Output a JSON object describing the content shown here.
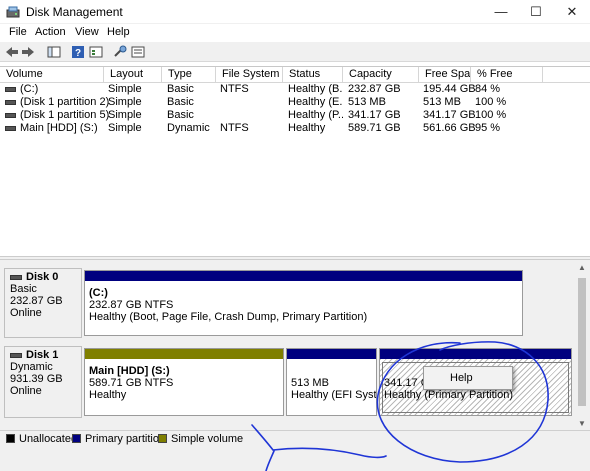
{
  "window": {
    "title": "Disk Management",
    "controls": {
      "minimize": "—",
      "maximize": "☐",
      "close": "✕"
    }
  },
  "menu": [
    "File",
    "Action",
    "View",
    "Help"
  ],
  "toolbar": {
    "icons": [
      "back-arrow-icon",
      "forward-arrow-icon",
      "console-tree-icon",
      "help-icon",
      "properties-icon",
      "connect-icon",
      "list-view-icon"
    ]
  },
  "table": {
    "columns": [
      "Volume",
      "Layout",
      "Type",
      "File System",
      "Status",
      "Capacity",
      "Free Spa...",
      "% Free"
    ],
    "rows": [
      {
        "volume": "(C:)",
        "layout": "Simple",
        "type": "Basic",
        "fs": "NTFS",
        "status": "Healthy (B...",
        "capacity": "232.87 GB",
        "free": "195.44 GB",
        "pct": "84 %"
      },
      {
        "volume": "(Disk 1 partition 2)",
        "layout": "Simple",
        "type": "Basic",
        "fs": "",
        "status": "Healthy (E...",
        "capacity": "513 MB",
        "free": "513 MB",
        "pct": "100 %"
      },
      {
        "volume": "(Disk 1 partition 5)",
        "layout": "Simple",
        "type": "Basic",
        "fs": "",
        "status": "Healthy (P...",
        "capacity": "341.17 GB",
        "free": "341.17 GB",
        "pct": "100 %"
      },
      {
        "volume": "Main [HDD] (S:)",
        "layout": "Simple",
        "type": "Dynamic",
        "fs": "NTFS",
        "status": "Healthy",
        "capacity": "589.71 GB",
        "free": "561.66 GB",
        "pct": "95 %"
      }
    ]
  },
  "disks": [
    {
      "name": "Disk 0",
      "type": "Basic",
      "size": "232.87 GB",
      "state": "Online",
      "partitions": [
        {
          "title": "(C:)",
          "detail": "232.87 GB NTFS",
          "status": "Healthy (Boot, Page File, Crash Dump, Primary Partition)",
          "color": "#00007f"
        }
      ]
    },
    {
      "name": "Disk 1",
      "type": "Dynamic",
      "size": "931.39 GB",
      "state": "Online",
      "partitions": [
        {
          "title": "Main [HDD]  (S:)",
          "detail": "589.71 GB NTFS",
          "status": "Healthy",
          "color": "#7f7f00"
        },
        {
          "title": "",
          "detail": "513 MB",
          "status": "Healthy (EFI System",
          "color": "#00007f"
        },
        {
          "title": "",
          "detail": "341.17 GB",
          "status": "Healthy (Primary Partition)",
          "color": "#00007f"
        }
      ]
    }
  ],
  "legend": [
    {
      "label": "Unallocated",
      "color": "#000000"
    },
    {
      "label": "Primary partition",
      "color": "#00007f"
    },
    {
      "label": "Simple volume",
      "color": "#7f7f00"
    }
  ],
  "context_menu": {
    "items": [
      "Help"
    ]
  },
  "annotation": {
    "color": "#1f35d6"
  }
}
